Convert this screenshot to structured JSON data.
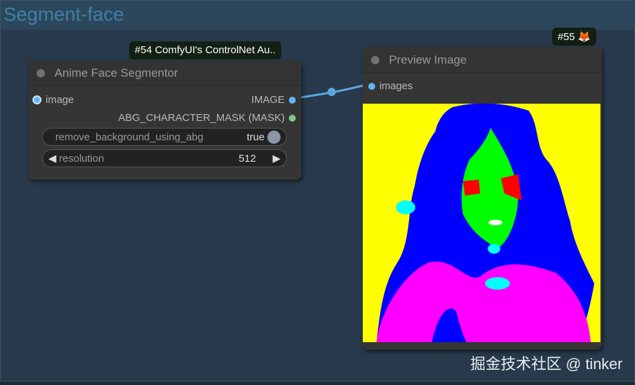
{
  "group": {
    "title": "Segment-face"
  },
  "node54": {
    "badge": "#54 ComfyUI's ControlNet Au..",
    "title": "Anime Face Segmentor",
    "input": "image",
    "outputs": [
      "IMAGE",
      "ABG_CHARACTER_MASK (MASK)"
    ],
    "widgets": {
      "remove_bg_label": "remove_background_using_abg",
      "remove_bg_value": "true",
      "resolution_label": "resolution",
      "resolution_value": "512",
      "left_arrow": "◀",
      "right_arrow": "▶"
    }
  },
  "node55": {
    "badge": "#55",
    "badge_icon": "🦊",
    "title": "Preview Image",
    "input": "images"
  },
  "colors": {
    "image_socket": "#64b5f6",
    "mask_socket": "#81c784"
  },
  "watermark": "掘金技术社区 @ tinker"
}
